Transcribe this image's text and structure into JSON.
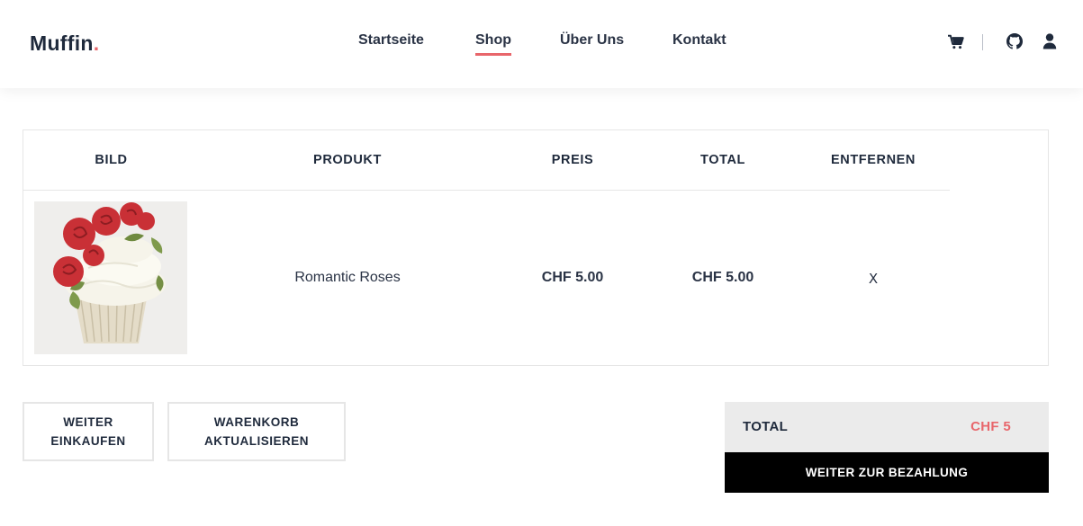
{
  "brand": {
    "name": "Muffin",
    "dot": ".",
    "accent_color": "#e8666b"
  },
  "nav": {
    "items": [
      {
        "label": "Startseite"
      },
      {
        "label": "Shop",
        "active": true
      },
      {
        "label": "Über Uns"
      },
      {
        "label": "Kontakt"
      }
    ]
  },
  "header_icons": [
    "cart-icon",
    "github-icon",
    "user-icon"
  ],
  "cart_table": {
    "headers": [
      "BILD",
      "PRODUKT",
      "PREIS",
      "TOTAL",
      "ENTFERNEN"
    ],
    "rows": [
      {
        "image": "cupcake-image",
        "product": "Romantic Roses",
        "price": "CHF 5.00",
        "total": "CHF 5.00",
        "remove": "X"
      }
    ]
  },
  "buttons": {
    "continue_line1": "WEITER",
    "continue_line2": "EINKAUFEN",
    "update_line1": "WARENKORB",
    "update_line2": "AKTUALISIEREN"
  },
  "summary": {
    "total_label": "TOTAL",
    "total_value": "CHF 5",
    "checkout_label": "WEITER ZUR BEZAHLUNG"
  }
}
